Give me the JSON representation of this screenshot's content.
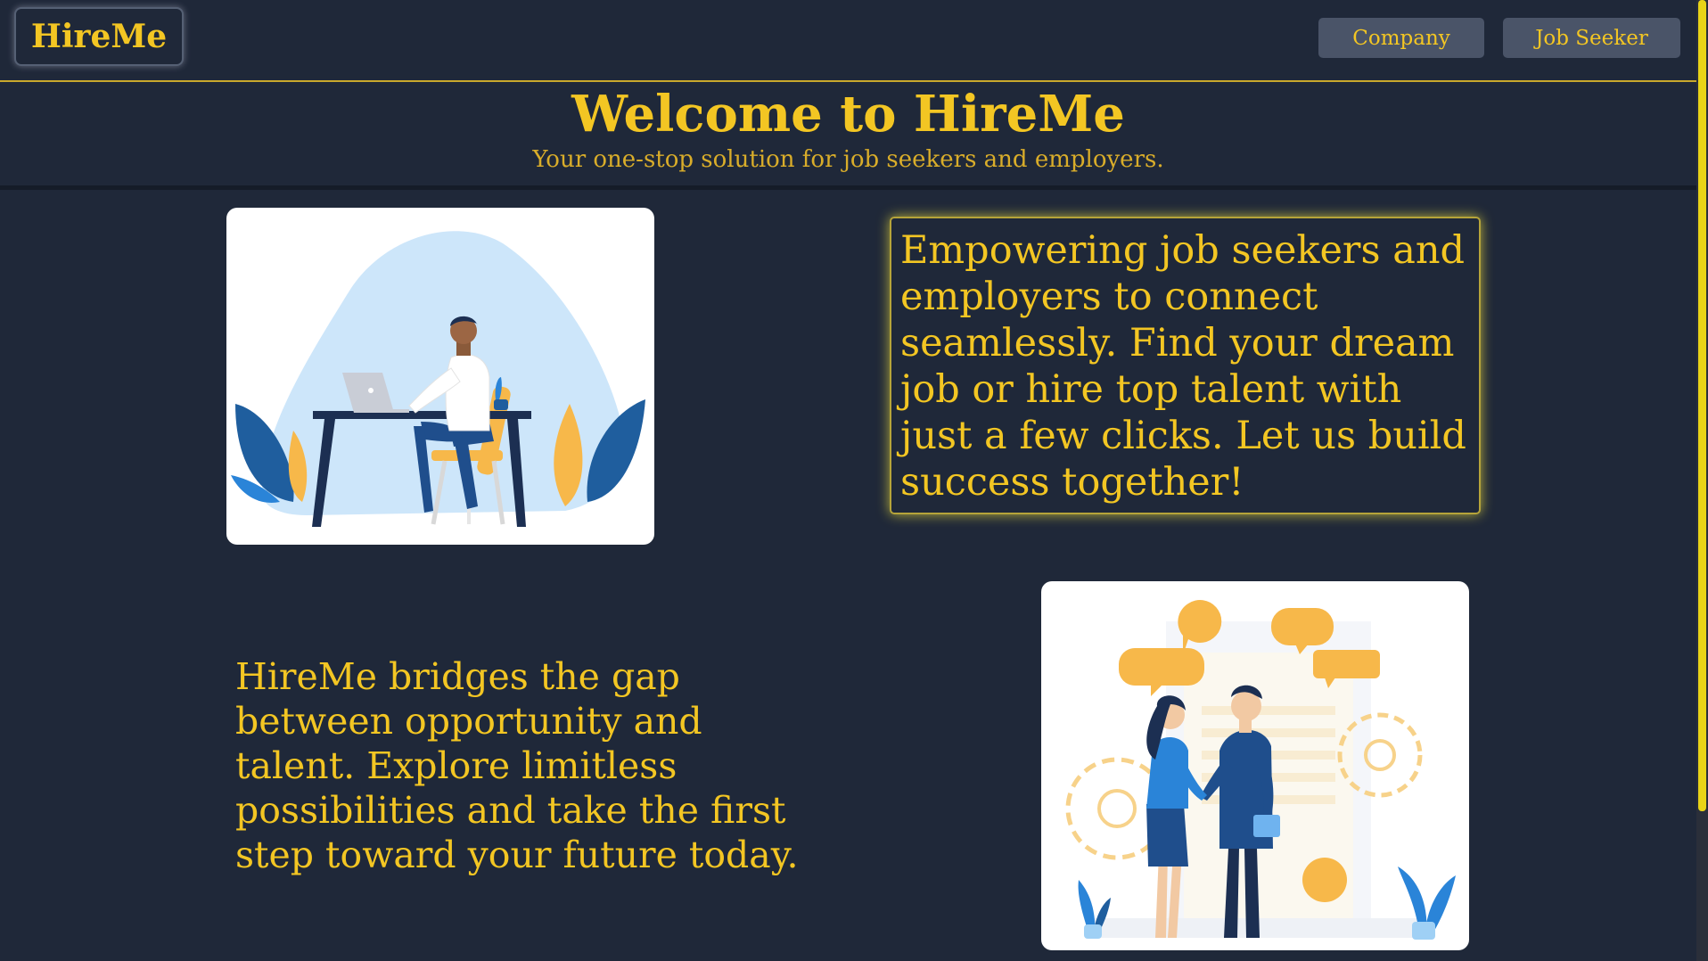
{
  "header": {
    "logo": "HireMe",
    "nav": {
      "company": "Company",
      "job_seeker": "Job Seeker"
    }
  },
  "hero": {
    "title": "Welcome to HireMe",
    "subtitle": "Your one-stop solution for job seekers and employers."
  },
  "sections": {
    "intro_text": "Empowering job seekers and employers to connect seamlessly. Find your dream job or hire top talent with just a few clicks. Let us build success together!",
    "bridge_text": "HireMe bridges the gap between opportunity and talent. Explore limitless possibilities and take the first step toward your future today."
  },
  "colors": {
    "background": "#1f2839",
    "accent": "#f3c623",
    "button": "#4a5468",
    "scrollbar": "#e9d417"
  },
  "icons": {
    "illustration_1": "person-at-desk-laptop-illustration",
    "illustration_2": "handshake-meeting-illustration"
  }
}
